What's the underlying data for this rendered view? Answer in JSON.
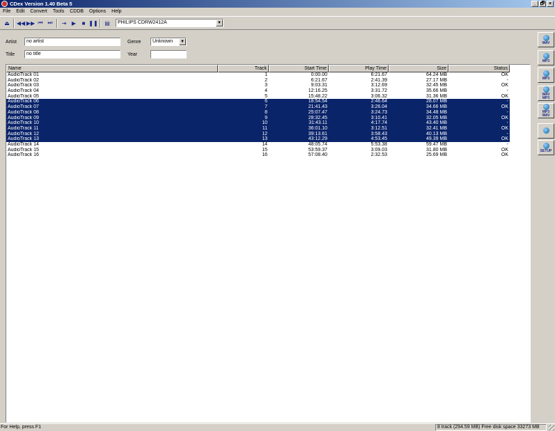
{
  "window": {
    "title": "CDex Version 1.40 Beta 5",
    "controls": [
      "_",
      "🗗",
      "×"
    ]
  },
  "menu": [
    "File",
    "Edit",
    "Convert",
    "Tools",
    "CDDB",
    "Options",
    "Help"
  ],
  "toolbar": {
    "drive": "PHILIPS CDRW2412A"
  },
  "form": {
    "artist_label": "Artist",
    "artist_value": "no artist",
    "title_label": "Title",
    "title_value": "no title",
    "genre_label": "Genre",
    "genre_value": "Unknown",
    "year_label": "Year",
    "year_value": ""
  },
  "table": {
    "columns": [
      "Name",
      "Track",
      "Start Time",
      "Play Time",
      "Size",
      "Status"
    ],
    "rows": [
      {
        "name": "AudioTrack 01",
        "track": "1",
        "start": "0:00.00",
        "play": "6:21.67",
        "size": "64.24 MB",
        "status": "OK",
        "selected": false
      },
      {
        "name": "AudioTrack 02",
        "track": "2",
        "start": "6:21.67",
        "play": "2:41.39",
        "size": "27.17 MB",
        "status": "-",
        "selected": false
      },
      {
        "name": "AudioTrack 03",
        "track": "3",
        "start": "9:03.31",
        "play": "3:12.69",
        "size": "32.45 MB",
        "status": "OK",
        "selected": false
      },
      {
        "name": "AudioTrack 04",
        "track": "4",
        "start": "12:16.25",
        "play": "3:31.72",
        "size": "35.66 MB",
        "status": "-",
        "selected": false
      },
      {
        "name": "AudioTrack 05",
        "track": "5",
        "start": "15:48.22",
        "play": "3:06.32",
        "size": "31.36 MB",
        "status": "OK",
        "selected": false
      },
      {
        "name": "AudioTrack 06",
        "track": "6",
        "start": "18:54.54",
        "play": "2:46.64",
        "size": "28.07 MB",
        "status": "-",
        "selected": true
      },
      {
        "name": "AudioTrack 07",
        "track": "7",
        "start": "21:41.43",
        "play": "3:26.04",
        "size": "34.66 MB",
        "status": "OK",
        "selected": true
      },
      {
        "name": "AudioTrack 08",
        "track": "8",
        "start": "25:07.47",
        "play": "3:24.73",
        "size": "34.48 MB",
        "status": "-",
        "selected": true
      },
      {
        "name": "AudioTrack 09",
        "track": "9",
        "start": "28:32.45",
        "play": "3:10.41",
        "size": "32.05 MB",
        "status": "OK",
        "selected": true
      },
      {
        "name": "AudioTrack 10",
        "track": "10",
        "start": "31:43.11",
        "play": "4:17.74",
        "size": "43.40 MB",
        "status": "-",
        "selected": true
      },
      {
        "name": "AudioTrack 11",
        "track": "11",
        "start": "36:01.10",
        "play": "3:12.51",
        "size": "32.41 MB",
        "status": "OK",
        "selected": true
      },
      {
        "name": "AudioTrack 12",
        "track": "12",
        "start": "39:13.61",
        "play": "3:58.43",
        "size": "40.13 MB",
        "status": "-",
        "selected": true
      },
      {
        "name": "AudioTrack 13",
        "track": "13",
        "start": "43:12.29",
        "play": "4:53.45",
        "size": "49.39 MB",
        "status": "OK",
        "selected": true
      },
      {
        "name": "AudioTrack 14",
        "track": "14",
        "start": "48:05.74",
        "play": "5:53.38",
        "size": "59.47 MB",
        "status": "-",
        "selected": false
      },
      {
        "name": "AudioTrack 15",
        "track": "15",
        "start": "53:59.37",
        "play": "3:09.03",
        "size": "31.80 MB",
        "status": "OK",
        "selected": false
      },
      {
        "name": "AudioTrack 16",
        "track": "16",
        "start": "57:08.40",
        "play": "2:32.53",
        "size": "25.69 MB",
        "status": "OK",
        "selected": false
      }
    ]
  },
  "sidebar": [
    {
      "icon": "cd-to-wav-icon",
      "line1": "WAV",
      "line2": ""
    },
    {
      "icon": "cd-to-mp3-icon",
      "line1": "MP3",
      "line2": ""
    },
    {
      "icon": "cd-track-to-mp3-icon",
      "line1": "MP3",
      "line2": ""
    },
    {
      "icon": "wav-to-mp3-icon",
      "line1": "WAV",
      "line2": "MP3"
    },
    {
      "icon": "mp3-to-wav-icon",
      "line1": "MP3",
      "line2": "WAV"
    },
    {
      "icon": "record-icon",
      "line1": "",
      "line2": ""
    },
    {
      "icon": "setup-icon",
      "line1": "SETUP",
      "line2": ""
    }
  ],
  "status": {
    "left": "For Help, press F1",
    "right": "8 track (294.59 MB) Free disk space 33273 MB"
  },
  "colors": {
    "selection": "#0a246a",
    "face": "#d4d0c8",
    "title_start": "#0a246a",
    "title_end": "#a6caf0"
  }
}
